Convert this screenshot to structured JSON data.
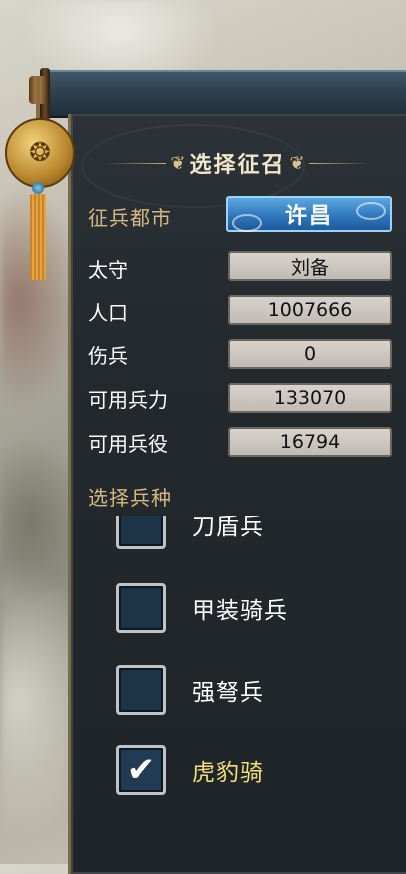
{
  "title": "选择征召",
  "city": {
    "label": "征兵都市",
    "value": "许昌"
  },
  "stats": [
    {
      "label": "太守",
      "value": "刘备"
    },
    {
      "label": "人口",
      "value": "1007666"
    },
    {
      "label": "伤兵",
      "value": "0"
    },
    {
      "label": "可用兵力",
      "value": "133070"
    },
    {
      "label": "可用兵役",
      "value": "16794"
    }
  ],
  "troop_section_label": "选择兵种",
  "troops": [
    {
      "label": "刀盾兵",
      "checked": false,
      "partial": true
    },
    {
      "label": "甲装骑兵",
      "checked": false
    },
    {
      "label": "强弩兵",
      "checked": false
    },
    {
      "label": "虎豹骑",
      "checked": true
    }
  ],
  "icons": {
    "check": "check-icon",
    "ornament": "ornament-disc-icon"
  },
  "colors": {
    "selected_troop": "#f2e07a",
    "city_button": "#2f78bd",
    "panel_bg": "#23292d"
  }
}
